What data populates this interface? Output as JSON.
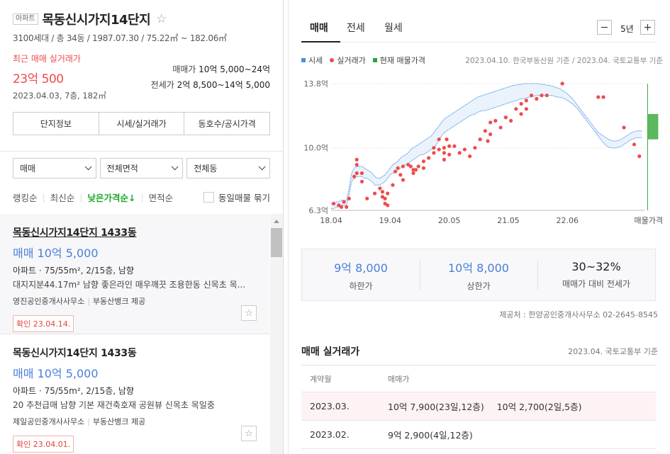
{
  "complex": {
    "type_badge": "아파트",
    "name": "목동신시가지14단지",
    "star_icon": "star-outline-icon",
    "info": "3100세대 / 총 34동 / 1987.07.30 / 75.22㎡ ~ 182.06㎡"
  },
  "recent_trade": {
    "label": "최근 매매 실거래가",
    "price": "23억 500",
    "date": "2023.04.03, 7층, 182㎡"
  },
  "price_ranges": {
    "sale_label": "매매가",
    "sale_value": "10억 5,000~24억",
    "jeonse_label": "전세가",
    "jeonse_value": "2억 8,500~14억 5,000"
  },
  "info_tabs": [
    "단지정보",
    "시세/실거래가",
    "동호수/공시가격"
  ],
  "filters": [
    "매매",
    "전체면적",
    "전체동"
  ],
  "sort": {
    "options": [
      "랭킹순",
      "최신순",
      "낮은가격순↓",
      "면적순"
    ],
    "active_index": 2,
    "same_listing_label": "동일매물 묶기"
  },
  "listings": [
    {
      "name": "목동신시가지14단지 1433동",
      "price": "매매 10억 5,000",
      "spec": "아파트 · 75/55m², 2/15층, 남향",
      "desc": "대지지분44.17m² 남향 좋은라인 매우깨끗 조용한동 신목초 목...",
      "agent": "영진공인중개사사무소",
      "provider": "부동산뱅크 제공",
      "confirm": "확인 23.04.14."
    },
    {
      "name": "목동신시가지14단지 1433동",
      "price": "매매 10억 5,000",
      "spec": "아파트 · 75/55m², 2/15층, 남향",
      "desc": "20 추천급매 남향 기본 재건축호재 공원뷰 신목초 목일중",
      "agent": "제일공인중개사사무소",
      "provider": "부동산뱅크 제공",
      "confirm": "확인 23.04.01."
    }
  ],
  "right_tabs": [
    "매매",
    "전세",
    "월세"
  ],
  "zoom": {
    "minus": "−",
    "value": "5년",
    "plus": "+"
  },
  "legend": {
    "items": [
      {
        "label": "시세",
        "color": "#4a90e2",
        "shape": "square"
      },
      {
        "label": "실거래가",
        "color": "#f04b4b",
        "shape": "dot"
      },
      {
        "label": "현재 매물가격",
        "color": "#2ca53e",
        "shape": "square"
      }
    ],
    "source": "2023.04.10. 한국부동산원 기준 / 2023.04. 국토교통부 기준"
  },
  "chart_data": {
    "type": "scatter",
    "y_ticks": [
      "13.8억",
      "10.0억",
      "6.3억"
    ],
    "x_ticks": [
      "18.04",
      "19.04",
      "20.05",
      "21.05",
      "22.06",
      "매물가격"
    ],
    "ylim": [
      6.3,
      13.8
    ],
    "market_band": {
      "name": "시세",
      "x": [
        0,
        0.5,
        1,
        1.5,
        2,
        2.5,
        3,
        3.5,
        4,
        4.5,
        5,
        5.5,
        6,
        6.5,
        7,
        7.5,
        8,
        8.5,
        9,
        9.5,
        10,
        10.5,
        11,
        11.5,
        12,
        12.5,
        13,
        13.5,
        14,
        14.5,
        15,
        15.5,
        16,
        16.5,
        17,
        17.5,
        18,
        18.5,
        19,
        19.5,
        20,
        20.5,
        21,
        21.5,
        22,
        22.5,
        23,
        23.5,
        24,
        24.5,
        25,
        25.5,
        26,
        26.5,
        27,
        27.5,
        28,
        28.5,
        29,
        29.5,
        30,
        30.5,
        31,
        31.5,
        32,
        32.5,
        33,
        33.5,
        34,
        34.5,
        35,
        35.5,
        36,
        36.5,
        37,
        37.5,
        38,
        38.5,
        39,
        39.5,
        40,
        40.5,
        41,
        41.5,
        42,
        42.5,
        43,
        43.5,
        44,
        44.5,
        45,
        45.5,
        46,
        46.5,
        47,
        47.5,
        48,
        48.5,
        49,
        49.5,
        50,
        50.5,
        51,
        51.5,
        52,
        52.5,
        53,
        53.5,
        54,
        54.5,
        55,
        55.5,
        56,
        56.5,
        57,
        57.5,
        58,
        58.5,
        59,
        59.5,
        60,
        60.5
      ],
      "low": [
        6.4,
        6.4,
        6.5,
        6.5,
        6.6,
        6.6,
        6.6,
        7.2,
        8.0,
        8.2,
        8.3,
        8.3,
        8.3,
        8.2,
        8.2,
        8.1,
        8.0,
        7.8,
        7.8,
        7.8,
        7.9,
        8.0,
        8.2,
        8.4,
        8.5,
        8.6,
        8.7,
        8.8,
        8.9,
        9.0,
        9.1,
        9.2,
        9.3,
        9.4,
        9.5,
        9.6,
        9.6,
        9.7,
        9.8,
        9.9,
        10.0,
        10.2,
        10.5,
        10.7,
        10.9,
        11.0,
        11.1,
        11.2,
        11.3,
        11.4,
        11.5,
        11.6,
        11.7,
        11.8,
        11.9,
        11.95,
        12.0,
        12.1,
        12.15,
        12.2,
        12.2,
        12.25,
        12.3,
        12.35,
        12.4,
        12.45,
        12.5,
        12.55,
        12.6,
        12.65,
        12.7,
        12.75,
        12.8,
        12.85,
        12.9,
        12.9,
        12.95,
        13.0,
        13.0,
        13.05,
        13.1,
        13.1,
        13.1,
        13.1,
        13.1,
        13.1,
        13.1,
        13.05,
        13.0,
        13.0,
        12.95,
        12.9,
        12.8,
        12.7,
        12.6,
        12.45,
        12.3,
        12.1,
        11.9,
        11.7,
        11.5,
        11.3,
        11.1,
        10.9,
        10.7,
        10.5,
        10.3,
        10.15,
        10.05,
        10.0,
        10.0,
        10.0,
        10.05,
        10.1,
        10.2,
        10.3,
        10.4,
        10.5,
        10.55,
        10.6,
        10.6,
        10.6
      ],
      "high": [
        6.7,
        6.7,
        6.8,
        6.8,
        6.9,
        6.9,
        6.9,
        7.6,
        8.5,
        8.8,
        8.9,
        8.9,
        8.9,
        8.8,
        8.7,
        8.6,
        8.5,
        8.3,
        8.2,
        8.2,
        8.3,
        8.4,
        8.6,
        8.8,
        9.0,
        9.1,
        9.2,
        9.4,
        9.5,
        9.6,
        9.7,
        9.9,
        10.0,
        10.1,
        10.2,
        10.3,
        10.4,
        10.5,
        10.6,
        10.7,
        10.9,
        11.1,
        11.3,
        11.5,
        11.7,
        11.8,
        11.9,
        12.0,
        12.1,
        12.2,
        12.3,
        12.4,
        12.5,
        12.6,
        12.7,
        12.8,
        12.9,
        13.0,
        13.05,
        13.1,
        13.15,
        13.2,
        13.25,
        13.3,
        13.35,
        13.4,
        13.45,
        13.5,
        13.55,
        13.6,
        13.65,
        13.7,
        13.7,
        13.75,
        13.75,
        13.8,
        13.8,
        13.8,
        13.8,
        13.8,
        13.8,
        13.8,
        13.75,
        13.75,
        13.7,
        13.7,
        13.65,
        13.6,
        13.55,
        13.5,
        13.4,
        13.3,
        13.2,
        13.05,
        12.9,
        12.7,
        12.5,
        12.3,
        12.1,
        11.9,
        11.7,
        11.5,
        11.3,
        11.1,
        10.9,
        10.8,
        10.7,
        10.6,
        10.5,
        10.45,
        10.4,
        10.4,
        10.45,
        10.5,
        10.6,
        10.7,
        10.8,
        10.9,
        10.95,
        11.0,
        11.0,
        11.0
      ]
    },
    "trades": {
      "name": "실거래가",
      "points": [
        [
          0.5,
          6.7
        ],
        [
          1.5,
          6.6
        ],
        [
          2,
          6.5
        ],
        [
          2.5,
          6.8
        ],
        [
          3,
          6.5
        ],
        [
          3.5,
          7.0
        ],
        [
          4.5,
          8.3
        ],
        [
          5,
          8.5
        ],
        [
          5,
          9.0
        ],
        [
          5,
          9.3
        ],
        [
          6,
          8.5
        ],
        [
          6,
          8.0
        ],
        [
          7,
          7.0
        ],
        [
          8.5,
          7.3
        ],
        [
          9.5,
          7.6
        ],
        [
          10,
          7.4
        ],
        [
          10,
          7.1
        ],
        [
          10.5,
          7.0
        ],
        [
          10.5,
          6.7
        ],
        [
          11,
          6.6
        ],
        [
          11,
          7.3
        ],
        [
          12,
          7.8
        ],
        [
          12.5,
          8.6
        ],
        [
          13,
          8.8
        ],
        [
          13.5,
          8.4
        ],
        [
          14,
          8.1
        ],
        [
          14,
          8.9
        ],
        [
          15,
          9.0
        ],
        [
          15.5,
          8.9
        ],
        [
          16,
          8.7
        ],
        [
          16,
          8.5
        ],
        [
          16.5,
          8.7
        ],
        [
          17,
          8.9
        ],
        [
          18,
          8.8
        ],
        [
          18,
          9.2
        ],
        [
          19,
          9.4
        ],
        [
          20,
          9.7
        ],
        [
          20,
          10.0
        ],
        [
          21,
          10.5
        ],
        [
          21,
          9.9
        ],
        [
          22,
          10.0
        ],
        [
          22,
          9.7
        ],
        [
          22,
          9.3
        ],
        [
          22.5,
          10.5
        ],
        [
          23,
          10.1
        ],
        [
          23,
          9.6
        ],
        [
          24,
          10.1
        ],
        [
          25,
          9.7
        ],
        [
          26,
          9.9
        ],
        [
          27,
          9.5
        ],
        [
          28,
          10.0
        ],
        [
          29,
          10.5
        ],
        [
          30,
          11.0
        ],
        [
          30.5,
          10.4
        ],
        [
          31,
          10.8
        ],
        [
          31,
          11.5
        ],
        [
          32,
          11.6
        ],
        [
          33,
          11.2
        ],
        [
          34,
          11.8
        ],
        [
          35,
          11.6
        ],
        [
          36,
          12.3
        ],
        [
          37,
          12.0
        ],
        [
          37,
          12.6
        ],
        [
          38,
          12.8
        ],
        [
          38,
          12.3
        ],
        [
          39,
          13.1
        ],
        [
          40,
          12.9
        ],
        [
          41,
          13.1
        ],
        [
          42,
          13.1
        ],
        [
          45,
          13.8
        ],
        [
          52,
          13.0
        ],
        [
          53,
          13.0
        ],
        [
          57,
          11.2
        ],
        [
          59,
          10.2
        ],
        [
          60,
          9.5
        ]
      ]
    },
    "current_listing": {
      "name": "현재 매물가격",
      "low": 10.5,
      "high": 12.0
    }
  },
  "summary": [
    {
      "value": "9억 8,000",
      "label": "하한가"
    },
    {
      "value": "10억 8,000",
      "label": "상한가"
    },
    {
      "value": "30~32%",
      "label": "매매가 대비 전세가"
    }
  ],
  "provider_note": "제공처 : 한양공인중개사사무소 02-2645-8545",
  "deals": {
    "title": "매매 실거래가",
    "source": "2023.04. 국토교통부 기준",
    "headers": [
      "계약월",
      "매매가"
    ],
    "rows": [
      {
        "month": "2023.03.",
        "prices": [
          "10억 7,900(23일,12층)",
          "10억 2,700(2일,5층)"
        ]
      },
      {
        "month": "2023.02.",
        "prices": [
          "9억 2,900(4일,12층)"
        ]
      }
    ]
  }
}
